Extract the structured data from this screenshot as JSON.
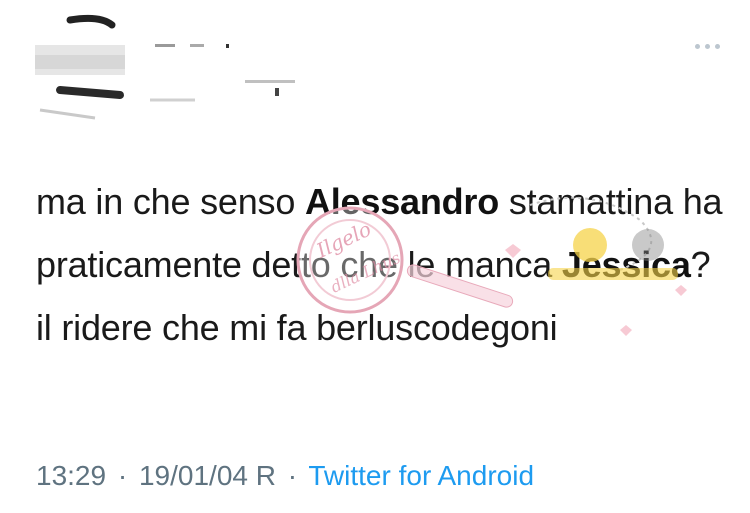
{
  "tweet": {
    "text_parts": [
      {
        "text": "ma in che senso ",
        "bold": false
      },
      {
        "text": "Alessandro",
        "bold": true
      },
      {
        "text": " stamattina ha praticamente detto che le manca ",
        "bold": false
      },
      {
        "text": "Jessica",
        "bold": true
      },
      {
        "text": "? il ridere che mi fa berluscodegoni",
        "bold": false
      }
    ],
    "time": "13:29",
    "date": "19/01/04 R",
    "separator": "·",
    "source": "Twitter for Android"
  },
  "watermark": {
    "text": "Ilgelo dlla Lhus"
  },
  "colors": {
    "source_link": "#1d9bf0",
    "meta_text": "#5f7380",
    "menu_dots": "#bcc6cf"
  },
  "icons": {
    "more_menu": "ellipsis-horizontal-icon"
  }
}
